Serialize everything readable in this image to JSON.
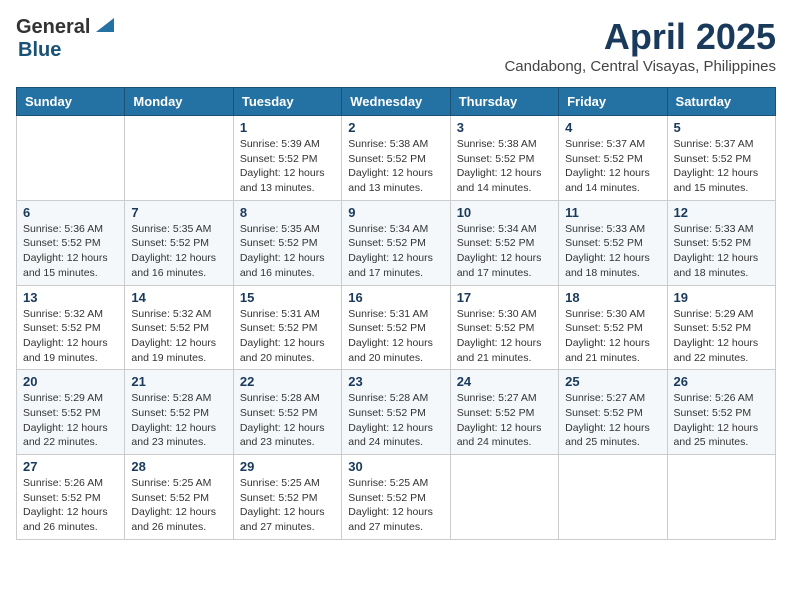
{
  "header": {
    "logo_general": "General",
    "logo_blue": "Blue",
    "title": "April 2025",
    "subtitle": "Candabong, Central Visayas, Philippines"
  },
  "days_of_week": [
    "Sunday",
    "Monday",
    "Tuesday",
    "Wednesday",
    "Thursday",
    "Friday",
    "Saturday"
  ],
  "weeks": [
    [
      {
        "day": "",
        "sunrise": "",
        "sunset": "",
        "daylight": ""
      },
      {
        "day": "",
        "sunrise": "",
        "sunset": "",
        "daylight": ""
      },
      {
        "day": "1",
        "sunrise": "Sunrise: 5:39 AM",
        "sunset": "Sunset: 5:52 PM",
        "daylight": "Daylight: 12 hours and 13 minutes."
      },
      {
        "day": "2",
        "sunrise": "Sunrise: 5:38 AM",
        "sunset": "Sunset: 5:52 PM",
        "daylight": "Daylight: 12 hours and 13 minutes."
      },
      {
        "day": "3",
        "sunrise": "Sunrise: 5:38 AM",
        "sunset": "Sunset: 5:52 PM",
        "daylight": "Daylight: 12 hours and 14 minutes."
      },
      {
        "day": "4",
        "sunrise": "Sunrise: 5:37 AM",
        "sunset": "Sunset: 5:52 PM",
        "daylight": "Daylight: 12 hours and 14 minutes."
      },
      {
        "day": "5",
        "sunrise": "Sunrise: 5:37 AM",
        "sunset": "Sunset: 5:52 PM",
        "daylight": "Daylight: 12 hours and 15 minutes."
      }
    ],
    [
      {
        "day": "6",
        "sunrise": "Sunrise: 5:36 AM",
        "sunset": "Sunset: 5:52 PM",
        "daylight": "Daylight: 12 hours and 15 minutes."
      },
      {
        "day": "7",
        "sunrise": "Sunrise: 5:35 AM",
        "sunset": "Sunset: 5:52 PM",
        "daylight": "Daylight: 12 hours and 16 minutes."
      },
      {
        "day": "8",
        "sunrise": "Sunrise: 5:35 AM",
        "sunset": "Sunset: 5:52 PM",
        "daylight": "Daylight: 12 hours and 16 minutes."
      },
      {
        "day": "9",
        "sunrise": "Sunrise: 5:34 AM",
        "sunset": "Sunset: 5:52 PM",
        "daylight": "Daylight: 12 hours and 17 minutes."
      },
      {
        "day": "10",
        "sunrise": "Sunrise: 5:34 AM",
        "sunset": "Sunset: 5:52 PM",
        "daylight": "Daylight: 12 hours and 17 minutes."
      },
      {
        "day": "11",
        "sunrise": "Sunrise: 5:33 AM",
        "sunset": "Sunset: 5:52 PM",
        "daylight": "Daylight: 12 hours and 18 minutes."
      },
      {
        "day": "12",
        "sunrise": "Sunrise: 5:33 AM",
        "sunset": "Sunset: 5:52 PM",
        "daylight": "Daylight: 12 hours and 18 minutes."
      }
    ],
    [
      {
        "day": "13",
        "sunrise": "Sunrise: 5:32 AM",
        "sunset": "Sunset: 5:52 PM",
        "daylight": "Daylight: 12 hours and 19 minutes."
      },
      {
        "day": "14",
        "sunrise": "Sunrise: 5:32 AM",
        "sunset": "Sunset: 5:52 PM",
        "daylight": "Daylight: 12 hours and 19 minutes."
      },
      {
        "day": "15",
        "sunrise": "Sunrise: 5:31 AM",
        "sunset": "Sunset: 5:52 PM",
        "daylight": "Daylight: 12 hours and 20 minutes."
      },
      {
        "day": "16",
        "sunrise": "Sunrise: 5:31 AM",
        "sunset": "Sunset: 5:52 PM",
        "daylight": "Daylight: 12 hours and 20 minutes."
      },
      {
        "day": "17",
        "sunrise": "Sunrise: 5:30 AM",
        "sunset": "Sunset: 5:52 PM",
        "daylight": "Daylight: 12 hours and 21 minutes."
      },
      {
        "day": "18",
        "sunrise": "Sunrise: 5:30 AM",
        "sunset": "Sunset: 5:52 PM",
        "daylight": "Daylight: 12 hours and 21 minutes."
      },
      {
        "day": "19",
        "sunrise": "Sunrise: 5:29 AM",
        "sunset": "Sunset: 5:52 PM",
        "daylight": "Daylight: 12 hours and 22 minutes."
      }
    ],
    [
      {
        "day": "20",
        "sunrise": "Sunrise: 5:29 AM",
        "sunset": "Sunset: 5:52 PM",
        "daylight": "Daylight: 12 hours and 22 minutes."
      },
      {
        "day": "21",
        "sunrise": "Sunrise: 5:28 AM",
        "sunset": "Sunset: 5:52 PM",
        "daylight": "Daylight: 12 hours and 23 minutes."
      },
      {
        "day": "22",
        "sunrise": "Sunrise: 5:28 AM",
        "sunset": "Sunset: 5:52 PM",
        "daylight": "Daylight: 12 hours and 23 minutes."
      },
      {
        "day": "23",
        "sunrise": "Sunrise: 5:28 AM",
        "sunset": "Sunset: 5:52 PM",
        "daylight": "Daylight: 12 hours and 24 minutes."
      },
      {
        "day": "24",
        "sunrise": "Sunrise: 5:27 AM",
        "sunset": "Sunset: 5:52 PM",
        "daylight": "Daylight: 12 hours and 24 minutes."
      },
      {
        "day": "25",
        "sunrise": "Sunrise: 5:27 AM",
        "sunset": "Sunset: 5:52 PM",
        "daylight": "Daylight: 12 hours and 25 minutes."
      },
      {
        "day": "26",
        "sunrise": "Sunrise: 5:26 AM",
        "sunset": "Sunset: 5:52 PM",
        "daylight": "Daylight: 12 hours and 25 minutes."
      }
    ],
    [
      {
        "day": "27",
        "sunrise": "Sunrise: 5:26 AM",
        "sunset": "Sunset: 5:52 PM",
        "daylight": "Daylight: 12 hours and 26 minutes."
      },
      {
        "day": "28",
        "sunrise": "Sunrise: 5:25 AM",
        "sunset": "Sunset: 5:52 PM",
        "daylight": "Daylight: 12 hours and 26 minutes."
      },
      {
        "day": "29",
        "sunrise": "Sunrise: 5:25 AM",
        "sunset": "Sunset: 5:52 PM",
        "daylight": "Daylight: 12 hours and 27 minutes."
      },
      {
        "day": "30",
        "sunrise": "Sunrise: 5:25 AM",
        "sunset": "Sunset: 5:52 PM",
        "daylight": "Daylight: 12 hours and 27 minutes."
      },
      {
        "day": "",
        "sunrise": "",
        "sunset": "",
        "daylight": ""
      },
      {
        "day": "",
        "sunrise": "",
        "sunset": "",
        "daylight": ""
      },
      {
        "day": "",
        "sunrise": "",
        "sunset": "",
        "daylight": ""
      }
    ]
  ]
}
